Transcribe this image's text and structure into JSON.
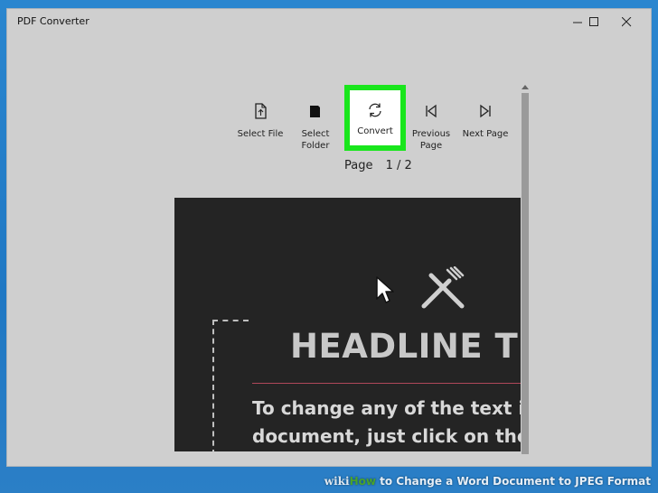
{
  "window": {
    "title": "PDF Converter"
  },
  "toolbar": {
    "select_file": "Select File",
    "select_folder": "Select\nFolder",
    "convert": "Convert",
    "previous_page": "Previous\nPage",
    "next_page": "Next Page"
  },
  "pagination": {
    "label": "Page",
    "value": "1 / 2"
  },
  "document": {
    "headline": "HEADLINE TI",
    "body_line_1": "To change any of the text in",
    "body_line_2": "document, just click on the b"
  },
  "watermark": {
    "wiki": "wiki",
    "how": "How",
    "rest": " to Change a Word Document to JPEG Format"
  },
  "colors": {
    "highlight": "#19e61c",
    "desktop": "#2a86cf",
    "document_bg": "#242424"
  }
}
